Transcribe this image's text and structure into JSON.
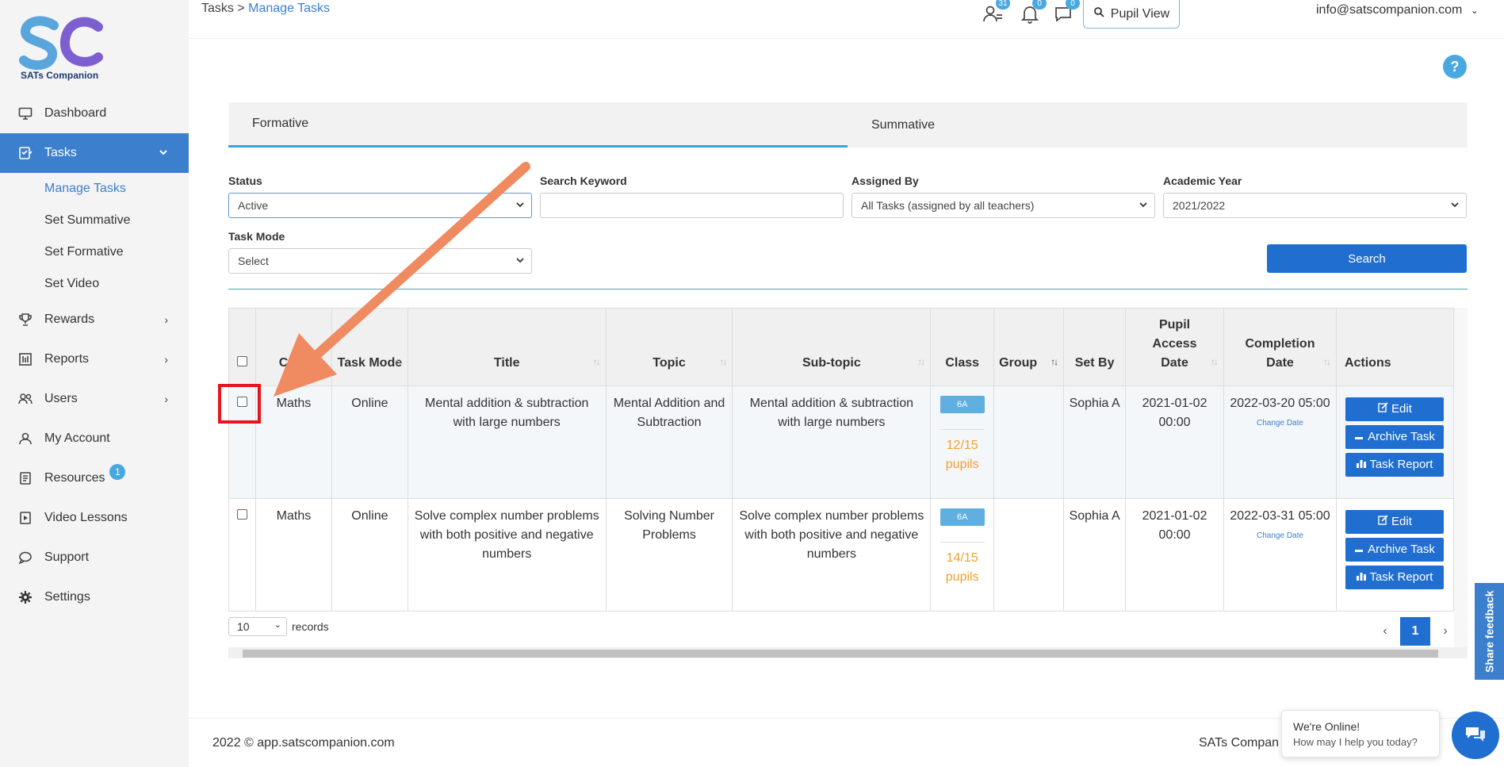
{
  "brand": {
    "logo_text": "SATs Companion",
    "accent": "#3c7fcd"
  },
  "sidebar": {
    "items": [
      {
        "label": "Dashboard",
        "icon": "monitor-icon"
      },
      {
        "label": "Tasks",
        "icon": "clipboard-icon"
      },
      {
        "label": "Rewards",
        "icon": "trophy-icon"
      },
      {
        "label": "Reports",
        "icon": "report-icon"
      },
      {
        "label": "Users",
        "icon": "users-icon"
      },
      {
        "label": "My Account",
        "icon": "account-icon"
      },
      {
        "label": "Resources",
        "icon": "book-icon",
        "badge": "1"
      },
      {
        "label": "Video Lessons",
        "icon": "video-icon"
      },
      {
        "label": "Support",
        "icon": "chat-icon"
      },
      {
        "label": "Settings",
        "icon": "gear-icon"
      }
    ],
    "tasks_sub": [
      "Manage Tasks",
      "Set Summative",
      "Set Formative",
      "Set Video"
    ]
  },
  "header": {
    "breadcrumb_root": "Tasks",
    "breadcrumb_sep": ">",
    "breadcrumb_current": "Manage Tasks",
    "pupil_view": "Pupil View",
    "users_count": "31",
    "notif_count": "0",
    "msg_count": "0",
    "email": "info@satscompanion.com"
  },
  "tabs": [
    "Formative",
    "Summative"
  ],
  "filters": {
    "status_label": "Status",
    "status_value": "Active",
    "keyword_label": "Search Keyword",
    "keyword_value": "",
    "assigned_label": "Assigned By",
    "assigned_value": "All Tasks (assigned by all teachers)",
    "year_label": "Academic Year",
    "year_value": "2021/2022",
    "mode_label": "Task Mode",
    "mode_value": "Select",
    "search_button": "Search"
  },
  "table": {
    "headers": {
      "course": "Cour",
      "mode": "Task Mode",
      "title": "Title",
      "topic": "Topic",
      "subtopic": "Sub-topic",
      "class": "Class",
      "group": "Group",
      "setby": "Set By",
      "access": "Pupil Access Date",
      "completion": "Completion Date",
      "actions": "Actions"
    },
    "rows": [
      {
        "course": "Maths",
        "mode": "Online",
        "title": "Mental addition & subtraction with large numbers",
        "topic": "Mental Addition and Subtraction",
        "subtopic": "Mental addition & subtraction with large numbers",
        "class": "6A",
        "pupils": "12/15 pupils",
        "group": "",
        "setby": "Sophia A",
        "access": "2021-01-02 00:00",
        "completion": "2022-03-20 05:00",
        "change_date": "Change Date"
      },
      {
        "course": "Maths",
        "mode": "Online",
        "title": "Solve complex number problems with both positive and negative numbers",
        "topic": "Solving Number Problems",
        "subtopic": "Solve complex number problems with both positive and negative numbers",
        "class": "6A",
        "pupils": "14/15 pupils",
        "group": "",
        "setby": "Sophia A",
        "access": "2021-01-02 00:00",
        "completion": "2022-03-31 05:00",
        "change_date": "Change Date"
      }
    ],
    "actions": {
      "edit": "Edit",
      "archive": "Archive Task",
      "report": "Task Report"
    }
  },
  "pagination": {
    "page_size": "10",
    "records_label": "records",
    "current_page": "1",
    "prev": "‹",
    "next": "›"
  },
  "footer": {
    "copyright": "2022 © app.satscompanion.com",
    "right": "SATs Compan"
  },
  "chat": {
    "line1": "We're Online!",
    "line2": "How may I help you today?"
  },
  "feedback": "Share feedback",
  "help": "?"
}
